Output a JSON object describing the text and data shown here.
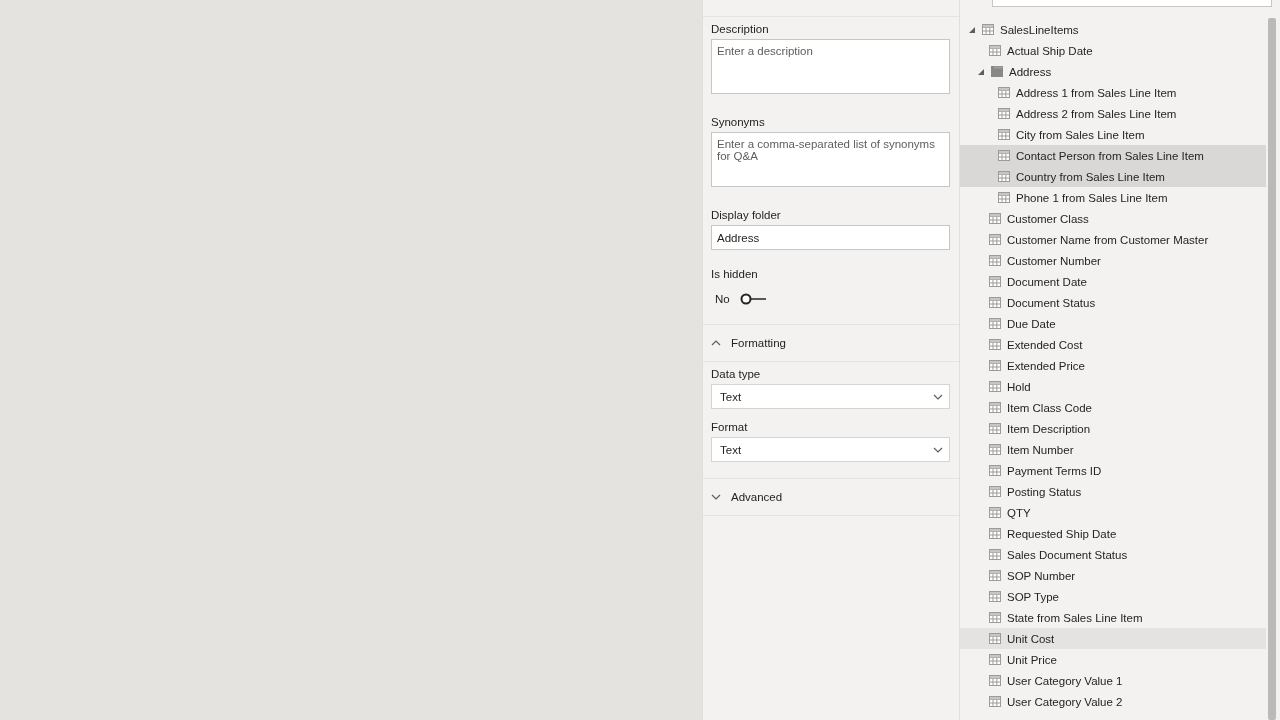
{
  "properties": {
    "description": {
      "label": "Description",
      "placeholder": "Enter a description"
    },
    "synonyms": {
      "label": "Synonyms",
      "placeholder": "Enter a comma-separated list of synonyms for Q&A"
    },
    "display_folder": {
      "label": "Display folder",
      "value": "Address"
    },
    "is_hidden": {
      "label": "Is hidden",
      "value_label": "No",
      "on": false
    },
    "sections": [
      {
        "title": "Formatting",
        "expanded": true,
        "fields": [
          {
            "label": "Data type",
            "value": "Text"
          },
          {
            "label": "Format",
            "value": "Text"
          }
        ]
      },
      {
        "title": "Advanced",
        "expanded": false
      }
    ]
  },
  "fields": {
    "tree": [
      {
        "label": "SalesLineItems",
        "kind": "table",
        "expanded": true,
        "selected": false,
        "hovered": false,
        "children": [
          {
            "label": "Actual Ship Date",
            "kind": "field",
            "selected": false,
            "hovered": false
          },
          {
            "label": "Address",
            "kind": "folder",
            "expanded": true,
            "selected": false,
            "hovered": false,
            "children": [
              {
                "label": "Address 1 from Sales Line Item",
                "kind": "field",
                "selected": false,
                "hovered": false
              },
              {
                "label": "Address 2 from Sales Line Item",
                "kind": "field",
                "selected": false,
                "hovered": false
              },
              {
                "label": "City from Sales Line Item",
                "kind": "field",
                "selected": false,
                "hovered": false
              },
              {
                "label": "Contact Person from Sales Line Item",
                "kind": "field",
                "selected": true,
                "hovered": false
              },
              {
                "label": "Country from Sales Line Item",
                "kind": "field",
                "selected": true,
                "hovered": false
              },
              {
                "label": "Phone 1 from Sales Line Item",
                "kind": "field",
                "selected": false,
                "hovered": false
              }
            ]
          },
          {
            "label": "Customer Class",
            "kind": "field",
            "selected": false,
            "hovered": false
          },
          {
            "label": "Customer Name from Customer Master",
            "kind": "field",
            "selected": false,
            "hovered": false
          },
          {
            "label": "Customer Number",
            "kind": "field",
            "selected": false,
            "hovered": false
          },
          {
            "label": "Document Date",
            "kind": "field",
            "selected": false,
            "hovered": false
          },
          {
            "label": "Document Status",
            "kind": "field",
            "selected": false,
            "hovered": false
          },
          {
            "label": "Due Date",
            "kind": "field",
            "selected": false,
            "hovered": false
          },
          {
            "label": "Extended Cost",
            "kind": "field",
            "selected": false,
            "hovered": false
          },
          {
            "label": "Extended Price",
            "kind": "field",
            "selected": false,
            "hovered": false
          },
          {
            "label": "Hold",
            "kind": "field",
            "selected": false,
            "hovered": false
          },
          {
            "label": "Item Class Code",
            "kind": "field",
            "selected": false,
            "hovered": false
          },
          {
            "label": "Item Description",
            "kind": "field",
            "selected": false,
            "hovered": false
          },
          {
            "label": "Item Number",
            "kind": "field",
            "selected": false,
            "hovered": false
          },
          {
            "label": "Payment Terms ID",
            "kind": "field",
            "selected": false,
            "hovered": false
          },
          {
            "label": "Posting Status",
            "kind": "field",
            "selected": false,
            "hovered": false
          },
          {
            "label": "QTY",
            "kind": "field",
            "selected": false,
            "hovered": false
          },
          {
            "label": "Requested Ship Date",
            "kind": "field",
            "selected": false,
            "hovered": false
          },
          {
            "label": "Sales Document Status",
            "kind": "field",
            "selected": false,
            "hovered": false
          },
          {
            "label": "SOP Number",
            "kind": "field",
            "selected": false,
            "hovered": false
          },
          {
            "label": "SOP Type",
            "kind": "field",
            "selected": false,
            "hovered": false
          },
          {
            "label": "State from Sales Line Item",
            "kind": "field",
            "selected": false,
            "hovered": false
          },
          {
            "label": "Unit Cost",
            "kind": "field",
            "selected": false,
            "hovered": true
          },
          {
            "label": "Unit Price",
            "kind": "field",
            "selected": false,
            "hovered": false
          },
          {
            "label": "User Category Value 1",
            "kind": "field",
            "selected": false,
            "hovered": false
          },
          {
            "label": "User Category Value 2",
            "kind": "field",
            "selected": false,
            "hovered": false
          }
        ]
      }
    ]
  }
}
